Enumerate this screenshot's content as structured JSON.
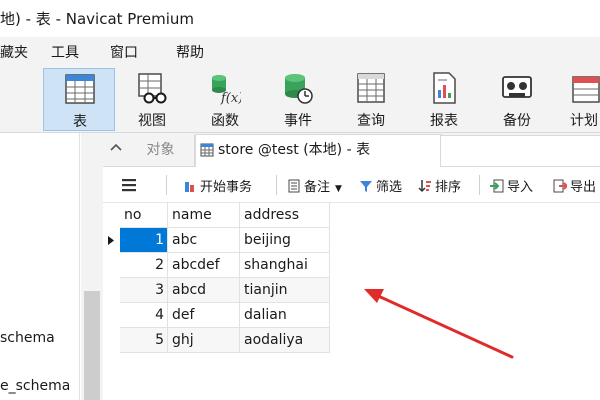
{
  "window": {
    "title": "地) - 表 - Navicat Premium"
  },
  "menu": [
    {
      "label": "藏夹"
    },
    {
      "label": "工具"
    },
    {
      "label": "窗口"
    },
    {
      "label": "帮助"
    }
  ],
  "toolbar": [
    {
      "label": "表",
      "icon": "table-icon",
      "active": true
    },
    {
      "label": "视图",
      "icon": "view-icon"
    },
    {
      "label": "函数",
      "icon": "function-icon"
    },
    {
      "label": "事件",
      "icon": "event-icon"
    },
    {
      "label": "查询",
      "icon": "query-icon"
    },
    {
      "label": "报表",
      "icon": "report-icon"
    },
    {
      "label": "备份",
      "icon": "backup-icon"
    },
    {
      "label": "计划",
      "icon": "schedule-icon"
    }
  ],
  "sidebar": {
    "items": [
      {
        "label": "schema"
      },
      {
        "label": "e_schema"
      }
    ]
  },
  "tabs": {
    "objects": "对象",
    "active": "store @test (本地) - 表"
  },
  "gridbar": {
    "begin_transaction": "开始事务",
    "memo": "备注",
    "filter": "筛选",
    "sort": "排序",
    "import": "导入",
    "export": "导出"
  },
  "grid": {
    "columns": [
      "no",
      "name",
      "address"
    ],
    "rows": [
      {
        "no": "1",
        "name": "abc",
        "address": "beijing"
      },
      {
        "no": "2",
        "name": "abcdef",
        "address": "shanghai"
      },
      {
        "no": "3",
        "name": "abcd",
        "address": "tianjin"
      },
      {
        "no": "4",
        "name": "def",
        "address": "dalian"
      },
      {
        "no": "5",
        "name": "ghj",
        "address": "aodaliya"
      }
    ],
    "selected_row": 0
  },
  "colors": {
    "selection": "#0078d7",
    "active_toolbar": "#cfe3f7",
    "annotation_arrow": "#e02b2b"
  }
}
